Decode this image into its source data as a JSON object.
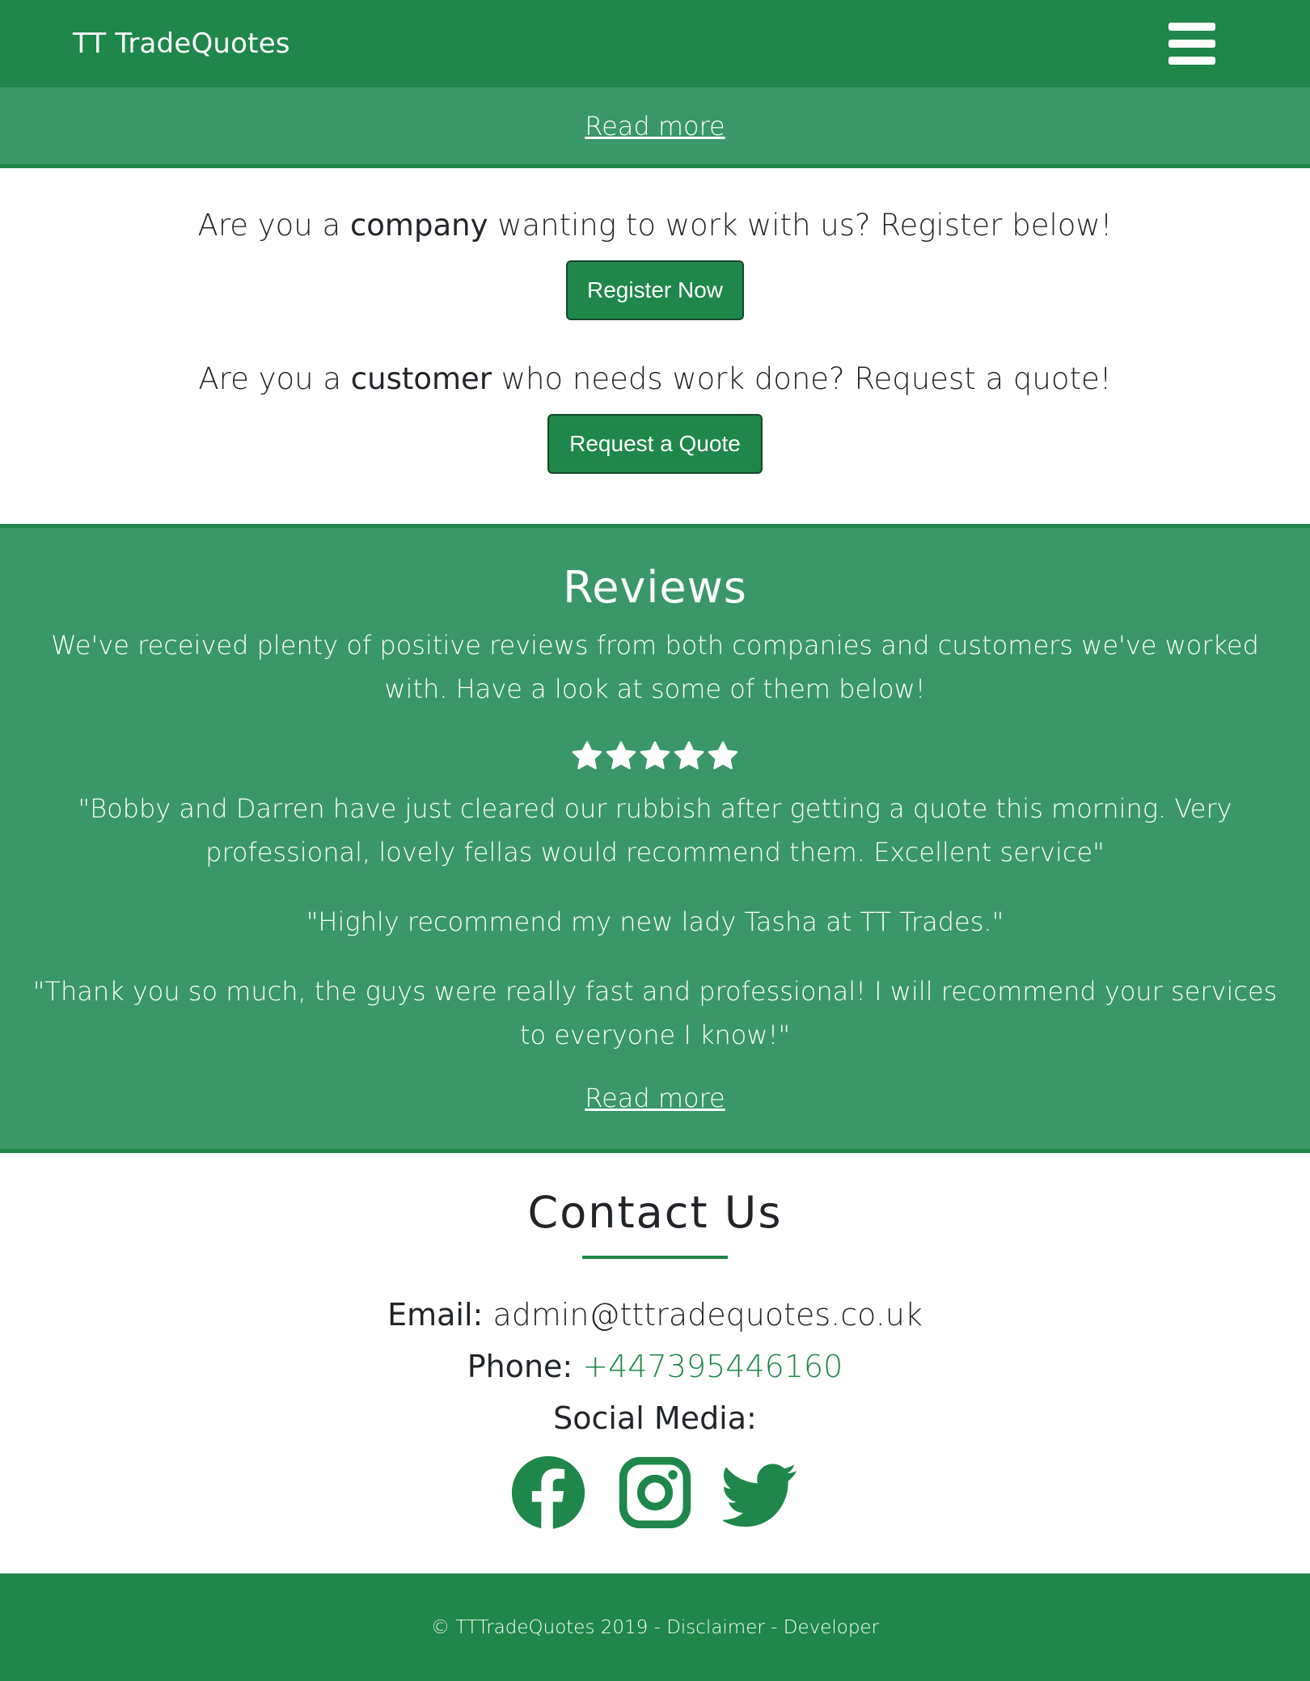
{
  "navbar": {
    "brand_prefix": "TT",
    "brand_name": "TradeQuotes",
    "menu_icon": "hamburger-menu-icon"
  },
  "top_strip": {
    "read_more": "Read more"
  },
  "cta": {
    "company_pre": "Are you a ",
    "company_bold": "company",
    "company_post": " wanting to work with us? Register below!",
    "register_label": "Register Now",
    "customer_pre": "Are you a ",
    "customer_bold": "customer",
    "customer_post": " who needs work done? Request a quote!",
    "quote_label": "Request a Quote"
  },
  "reviews": {
    "title": "Reviews",
    "intro": "We've received plenty of positive reviews from both companies and customers we've worked with. Have a look at some of them below!",
    "rating": 5,
    "rating_max": 5,
    "star_icon": "star-icon",
    "quotes": [
      "\"Bobby and Darren have just cleared our rubbish after getting a quote this morning. Very professional, lovely fellas would recommend them. Excellent service\"",
      "\"Highly recommend my new lady Tasha at TT Trades.\"",
      "\"Thank you so much, the guys were really fast and professional! I will recommend your services to everyone I know!\""
    ],
    "read_more": "Read more"
  },
  "contact": {
    "title": "Contact Us",
    "email_label": "Email:",
    "email_value": "admin@tttradequotes.co.uk",
    "phone_label": "Phone:",
    "phone_value": "+447395446160",
    "social_label": "Social Media:",
    "social_icons": [
      "facebook-icon",
      "instagram-icon",
      "twitter-icon"
    ]
  },
  "footer": {
    "copyright": "© TTTradeQuotes 2019",
    "sep1": " - ",
    "disclaimer": "Disclaimer",
    "sep2": " - ",
    "developer": "Developer"
  },
  "colors": {
    "brand_green": "#1e8749",
    "section_green": "#3a976a",
    "text_dark": "#212529",
    "white": "#ffffff"
  }
}
